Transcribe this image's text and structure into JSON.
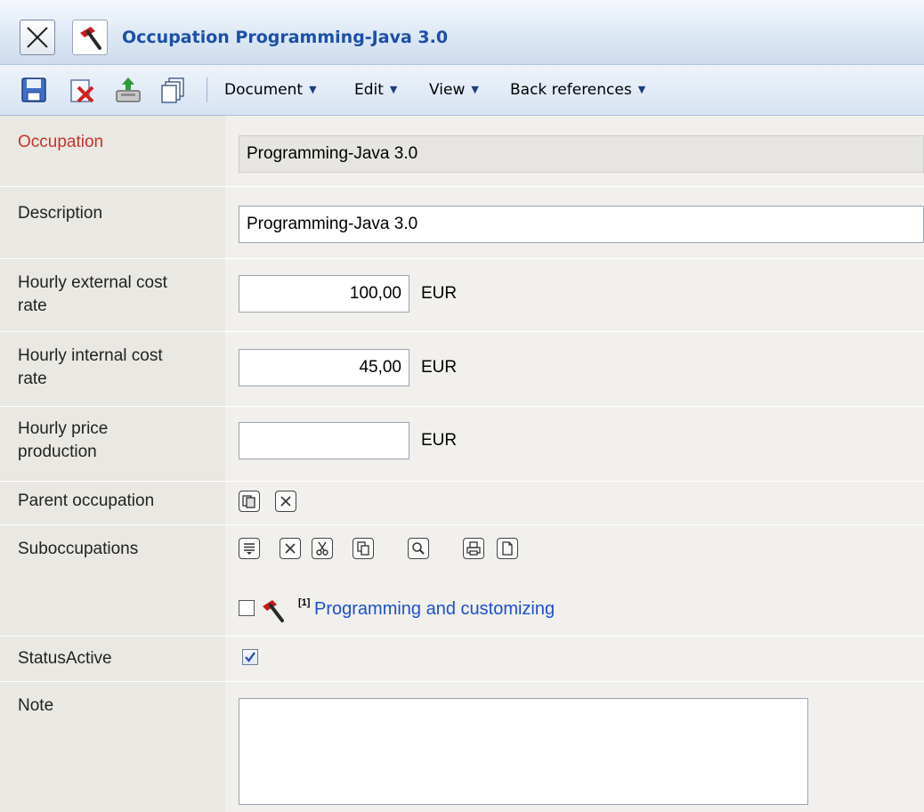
{
  "window": {
    "title": "Occupation Programming-Java 3.0"
  },
  "toolbar": {
    "icons": [
      "save-icon",
      "delete-icon",
      "export-icon",
      "copy-icon"
    ],
    "menus": [
      {
        "label": "Document"
      },
      {
        "label": "Edit"
      },
      {
        "label": "View"
      },
      {
        "label": "Back references"
      }
    ]
  },
  "form": {
    "occupation": {
      "label": "Occupation",
      "value": "Programming-Java 3.0"
    },
    "description": {
      "label": "Description",
      "value": "Programming-Java 3.0"
    },
    "external_rate": {
      "label_line1": "Hourly external cost",
      "label_line2": "rate",
      "value": "100,00",
      "unit": "EUR"
    },
    "internal_rate": {
      "label_line1": "Hourly internal cost",
      "label_line2": "rate",
      "value": "45,00",
      "unit": "EUR"
    },
    "price_production": {
      "label_line1": "Hourly price",
      "label_line2": "production",
      "value": "",
      "unit": "EUR"
    },
    "parent_occupation": {
      "label": "Parent occupation",
      "buttons": [
        "select-icon",
        "clear-icon"
      ]
    },
    "suboccupations": {
      "label": "Suboccupations",
      "buttons": [
        "list-icon",
        "remove-icon",
        "cut-icon",
        "copy-icon",
        "search-icon",
        "print-icon",
        "new-document-icon"
      ],
      "items": [
        {
          "index_badge": "[1]",
          "label": "Programming and customizing",
          "checked": false
        }
      ]
    },
    "status_active": {
      "label": "StatusActive",
      "checked": true
    },
    "note": {
      "label": "Note",
      "value": ""
    }
  },
  "colors": {
    "title_text": "#1b4fa8",
    "required_label": "#c8312b",
    "link": "#1e4fd1"
  }
}
